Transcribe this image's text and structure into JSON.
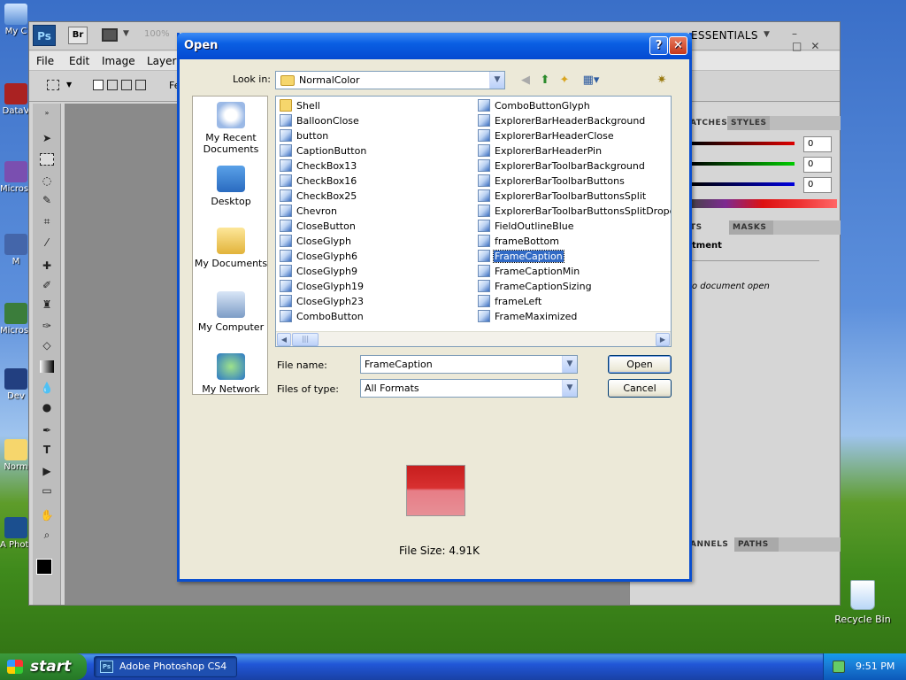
{
  "desktop": {
    "icons": [
      "My C",
      "DataV",
      "Micros C+",
      "M",
      "Micros Ba",
      "Dev",
      "Norm",
      "A Photo"
    ],
    "recycle_bin": "Recycle Bin"
  },
  "photoshop": {
    "logo": "Ps",
    "bridge": "Br",
    "zoom": "100%",
    "workspace": "ESSENTIALS",
    "menu": [
      "File",
      "Edit",
      "Image",
      "Layer"
    ],
    "opts_text": "Fe",
    "panels": {
      "tab_swatches": "ATCHES",
      "tab_styles": "STYLES",
      "color_values": [
        "0",
        "0",
        "0"
      ],
      "tab_adjustments": "TS",
      "tab_masks": "MASKS",
      "adjustment_heading": "tment",
      "no_document": "o document open",
      "tab_channels": "ANNELS",
      "tab_paths": "PATHS"
    }
  },
  "dialog": {
    "title": "Open",
    "help": "?",
    "close": "✕",
    "look_in_label": "Look in:",
    "look_in_value": "NormalColor",
    "places": [
      "My Recent Documents",
      "Desktop",
      "My Documents",
      "My Computer",
      "My Network"
    ],
    "files_col1": [
      "Shell",
      "BalloonClose",
      "button",
      "CaptionButton",
      "CheckBox13",
      "CheckBox16",
      "CheckBox25",
      "Chevron",
      "CloseButton",
      "CloseGlyph",
      "CloseGlyph6",
      "CloseGlyph9",
      "CloseGlyph19",
      "CloseGlyph23",
      "ComboButton"
    ],
    "files_col2": [
      "ComboButtonGlyph",
      "ExplorerBarHeaderBackground",
      "ExplorerBarHeaderClose",
      "ExplorerBarHeaderPin",
      "ExplorerBarToolbarBackground",
      "ExplorerBarToolbarButtons",
      "ExplorerBarToolbarButtonsSplit",
      "ExplorerBarToolbarButtonsSplitDropdown",
      "FieldOutlineBlue",
      "frameBottom",
      "FrameCaption",
      "FrameCaptionMin",
      "FrameCaptionSizing",
      "frameLeft",
      "FrameMaximized"
    ],
    "selected_file": "FrameCaption",
    "file_name_label": "File name:",
    "file_name_value": "FrameCaption",
    "file_type_label": "Files of type:",
    "file_type_value": "All Formats",
    "open_label": "Open",
    "cancel_label": "Cancel",
    "file_size": "File Size: 4.91K"
  },
  "taskbar": {
    "start": "start",
    "task": "Adobe Photoshop CS4",
    "clock": "9:51 PM"
  },
  "colors": {
    "title_bar": "#0449d1",
    "selection": "#316ac5",
    "preview_red": "#d83030"
  }
}
